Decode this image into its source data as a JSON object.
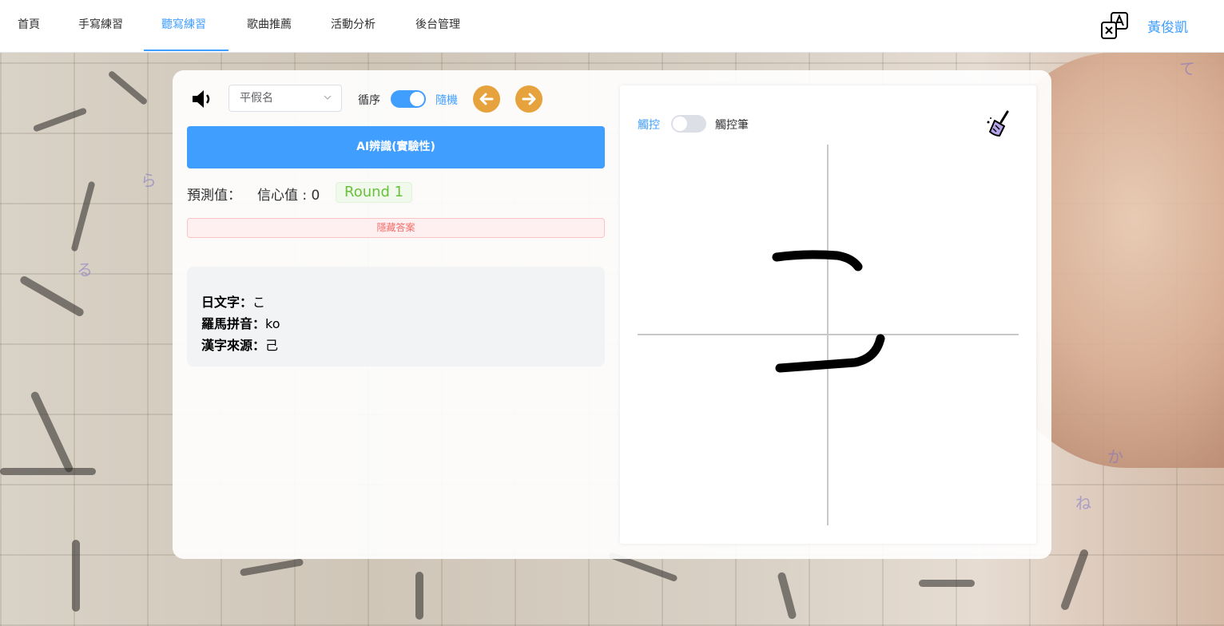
{
  "nav": {
    "items": [
      {
        "label": "首頁",
        "active": false
      },
      {
        "label": "手寫練習",
        "active": false
      },
      {
        "label": "聽寫練習",
        "active": true
      },
      {
        "label": "歌曲推薦",
        "active": false
      },
      {
        "label": "活動分析",
        "active": false
      },
      {
        "label": "後台管理",
        "active": false
      }
    ],
    "user_name": "黃俊凱",
    "translate_icon": "translate-icon"
  },
  "controls": {
    "speaker_icon": "speaker-icon",
    "kana_select": "平假名",
    "order_label": "循序",
    "order_random_on": true,
    "random_label": "隨機",
    "prev_icon": "arrow-left-icon",
    "next_icon": "arrow-right-icon"
  },
  "ai_button": "AI辨識(實驗性)",
  "prediction": {
    "pred_label": "預測值：",
    "conf_label": "信心值 : 0",
    "round_tag": "Round 1"
  },
  "hide_answer": "隱藏答案",
  "answer": {
    "jp_label": "日文字：",
    "jp_value": "こ",
    "romaji_label": "羅馬拼音：",
    "romaji_value": "ko",
    "kanji_label": "漢字來源：",
    "kanji_value": "己"
  },
  "canvas_panel": {
    "touch_label": "觸控",
    "touch_pen_on": false,
    "pen_label": "觸控筆",
    "clear_icon": "broom-icon"
  },
  "colors": {
    "primary": "#409eff",
    "warning": "#e6a23c",
    "success": "#67c23a",
    "danger": "#f56c6c"
  }
}
